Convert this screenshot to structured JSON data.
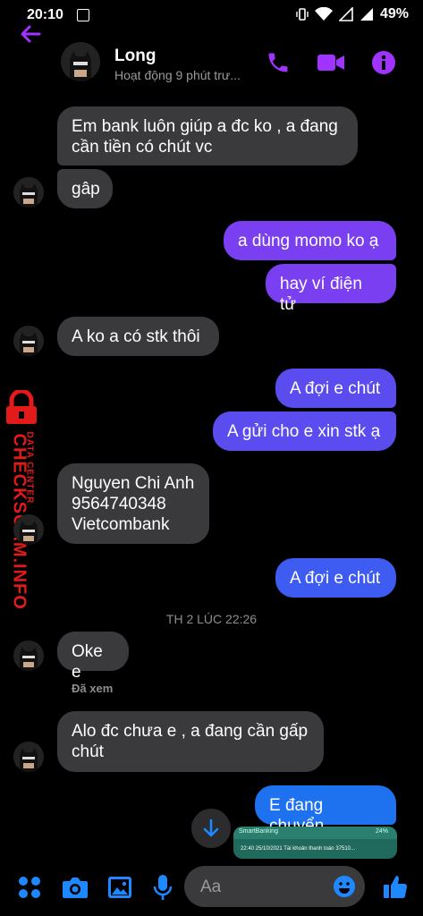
{
  "status_bar": {
    "time": "20:10",
    "battery": "49%"
  },
  "header": {
    "name": "Long",
    "activity": "Hoạt động 9 phút trư..."
  },
  "messages": {
    "m1": "Em bank luôn giúp a đc ko , a đang\ncần tiền có chút vc",
    "m2": "gâp",
    "m3": "a dùng momo ko ạ",
    "m4": "hay ví điện tử",
    "m5": "A ko a có stk thôi",
    "m6": "A đợi e chút",
    "m7": "A gửi cho e xin stk ạ",
    "m8": "Nguyen Chi Anh\n9564740348\nVietcombank",
    "m9": "A đợi e chút",
    "m10": "Oke e",
    "m11": "Alo đc chưa e , a đang cần gấp\nchút",
    "m12": "E đang chuyển"
  },
  "separator": "TH 2 LÚC 22:26",
  "seen_label": "Đã xem",
  "image_preview": {
    "app": "SmartBanking",
    "percent": "24%",
    "text": "22:40 25/10/2021 Tài khoản thanh toán 37510..."
  },
  "watermark": {
    "top": "DATA CENTER",
    "main": "CHECKSCAM.INFO"
  },
  "composer": {
    "placeholder": "Aa"
  },
  "colors": {
    "accent": "#a033ff",
    "blue": "#1e88ff",
    "incoming": "#3a3a3c"
  }
}
